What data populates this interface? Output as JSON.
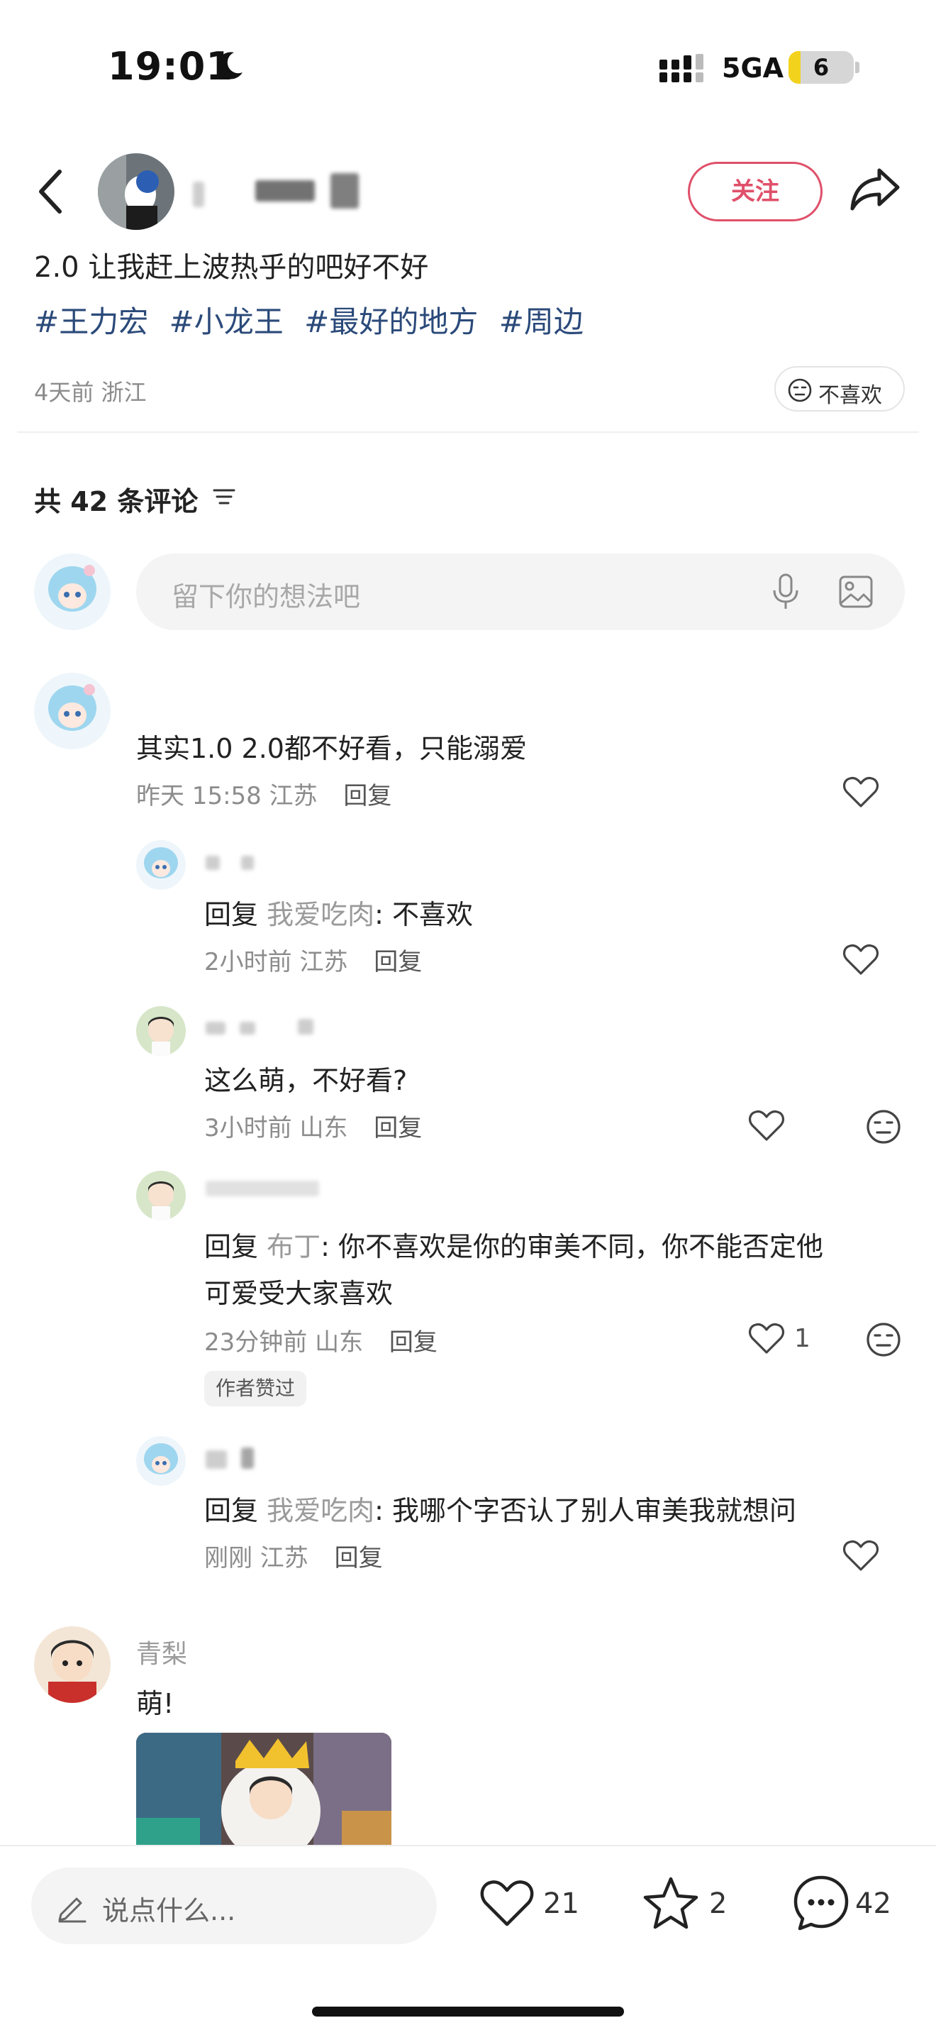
{
  "status_bar": {
    "time": "19:01",
    "network": "5GA",
    "battery": "6",
    "battery_fraction": 0.18
  },
  "header": {
    "follow_label": "关注"
  },
  "post": {
    "text": "2.0 让我赶上波热乎的吧好不好",
    "tags": [
      "#王力宏",
      "#小龙王",
      "#最好的地方",
      "#周边"
    ],
    "meta": "4天前 浙江",
    "dislike_label": "不喜欢"
  },
  "comments_header": {
    "count_label": "共 42 条评论"
  },
  "comment_input": {
    "placeholder": "留下你的想法吧"
  },
  "comments": [
    {
      "text": "其实1.0 2.0都不好看，只能溺爱",
      "meta": "昨天 15:58 江苏",
      "reply_label": "回复"
    },
    {
      "reply_kw": "回复",
      "reply_to": "我爱吃肉",
      "text": ": 不喜欢",
      "meta": "2小时前 江苏",
      "reply_label": "回复"
    },
    {
      "text": "这么萌，不好看?",
      "meta": "3小时前 山东",
      "reply_label": "回复"
    },
    {
      "reply_kw": "回复",
      "reply_to": "布丁",
      "text": ": 你不喜欢是你的审美不同，你不能否定他",
      "text2": "可爱受大家喜欢",
      "meta": "23分钟前 山东",
      "reply_label": "回复",
      "likes": "1",
      "badge": "作者赞过"
    },
    {
      "reply_kw": "回复",
      "reply_to": "我爱吃肉",
      "text": ": 我哪个字否认了别人审美我就想问",
      "meta": "刚刚 江苏",
      "reply_label": "回复"
    },
    {
      "username": "青梨",
      "text": "萌!"
    }
  ],
  "bottom_bar": {
    "input_label": "说点什么...",
    "likes": "21",
    "stars": "2",
    "comments": "42"
  },
  "colors": {
    "accent": "#e0506a",
    "tag": "#2b4a7a",
    "meta": "#8c8c8c"
  }
}
